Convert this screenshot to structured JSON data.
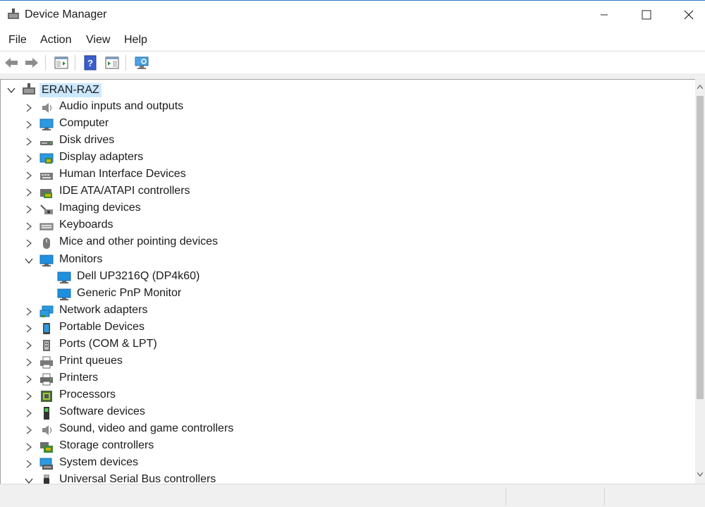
{
  "window": {
    "title": "Device Manager"
  },
  "menu": {
    "items": [
      "File",
      "Action",
      "View",
      "Help"
    ]
  },
  "tree": {
    "root": "ERAN-RAZ",
    "categories": [
      {
        "label": "Audio inputs and outputs",
        "icon": "speaker-icon"
      },
      {
        "label": "Computer",
        "icon": "computer-icon"
      },
      {
        "label": "Disk drives",
        "icon": "disk-drive-icon"
      },
      {
        "label": "Display adapters",
        "icon": "display-adapter-icon"
      },
      {
        "label": "Human Interface Devices",
        "icon": "hid-icon"
      },
      {
        "label": "IDE ATA/ATAPI controllers",
        "icon": "ide-controller-icon"
      },
      {
        "label": "Imaging devices",
        "icon": "camera-icon"
      },
      {
        "label": "Keyboards",
        "icon": "keyboard-icon"
      },
      {
        "label": "Mice and other pointing devices",
        "icon": "mouse-icon"
      },
      {
        "label": "Monitors",
        "icon": "monitor-icon",
        "expanded": true,
        "children": [
          {
            "label": "Dell UP3216Q (DP4k60)",
            "icon": "monitor-icon"
          },
          {
            "label": "Generic PnP Monitor",
            "icon": "monitor-icon"
          }
        ]
      },
      {
        "label": "Network adapters",
        "icon": "network-adapter-icon"
      },
      {
        "label": "Portable Devices",
        "icon": "portable-device-icon"
      },
      {
        "label": "Ports (COM & LPT)",
        "icon": "port-icon"
      },
      {
        "label": "Print queues",
        "icon": "print-queue-icon"
      },
      {
        "label": "Printers",
        "icon": "printer-icon"
      },
      {
        "label": "Processors",
        "icon": "processor-icon"
      },
      {
        "label": "Software devices",
        "icon": "software-device-icon"
      },
      {
        "label": "Sound, video and game controllers",
        "icon": "sound-icon"
      },
      {
        "label": "Storage controllers",
        "icon": "storage-controller-icon"
      },
      {
        "label": "System devices",
        "icon": "system-device-icon"
      },
      {
        "label": "Universal Serial Bus controllers",
        "icon": "usb-icon",
        "expanded": true
      }
    ]
  },
  "colors": {
    "selection": "#cce8ff",
    "accent": "#2b78c6",
    "monitor": "#1e90e0"
  }
}
